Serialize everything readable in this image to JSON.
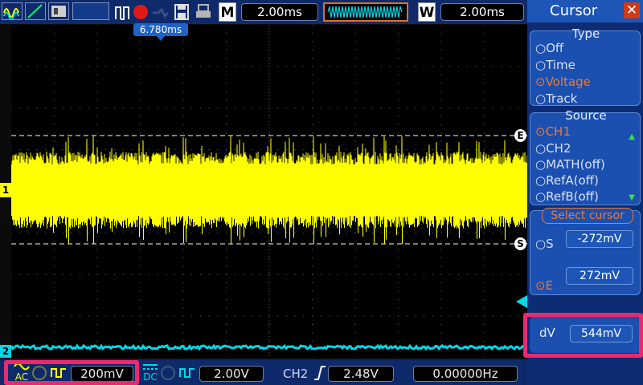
{
  "toolbar": {
    "timebase": "2.00ms",
    "window_base": "2.00ms",
    "memory_letter": "M",
    "window_letter": "W",
    "trigger_position": "6.780ms"
  },
  "channels": {
    "ch1_marker": "1",
    "ch2_marker": "2",
    "ch1_scale": "200mV",
    "ch1_coupling": "AC",
    "ch2_scale": "2.00V",
    "ch2_coupling": "DC"
  },
  "trigger": {
    "source": "CH2",
    "level": "2.48V",
    "frequency": "0.00000Hz"
  },
  "cursor_markers": {
    "end": "E",
    "start": "S"
  },
  "panel": {
    "title": "Cursor",
    "type_title": "Type",
    "type_options": [
      "Off",
      "Time",
      "Voltage",
      "Track"
    ],
    "type_selected": "Voltage",
    "source_title": "Source",
    "source_options": [
      "CH1",
      "CH2",
      "MATH(off)",
      "RefA(off)",
      "RefB(off)"
    ],
    "source_selected": "CH1",
    "select_cursor_title": "Select cursor",
    "s_label": "S",
    "s_value": "-272mV",
    "e_label": "E",
    "e_value": "272mV",
    "dv_label": "dV",
    "dv_value": "544mV"
  },
  "colors": {
    "ch1": "#ffff00",
    "ch2": "#00d8e8",
    "highlight": "#ea2a70",
    "selected_option": "#ee7a35"
  }
}
